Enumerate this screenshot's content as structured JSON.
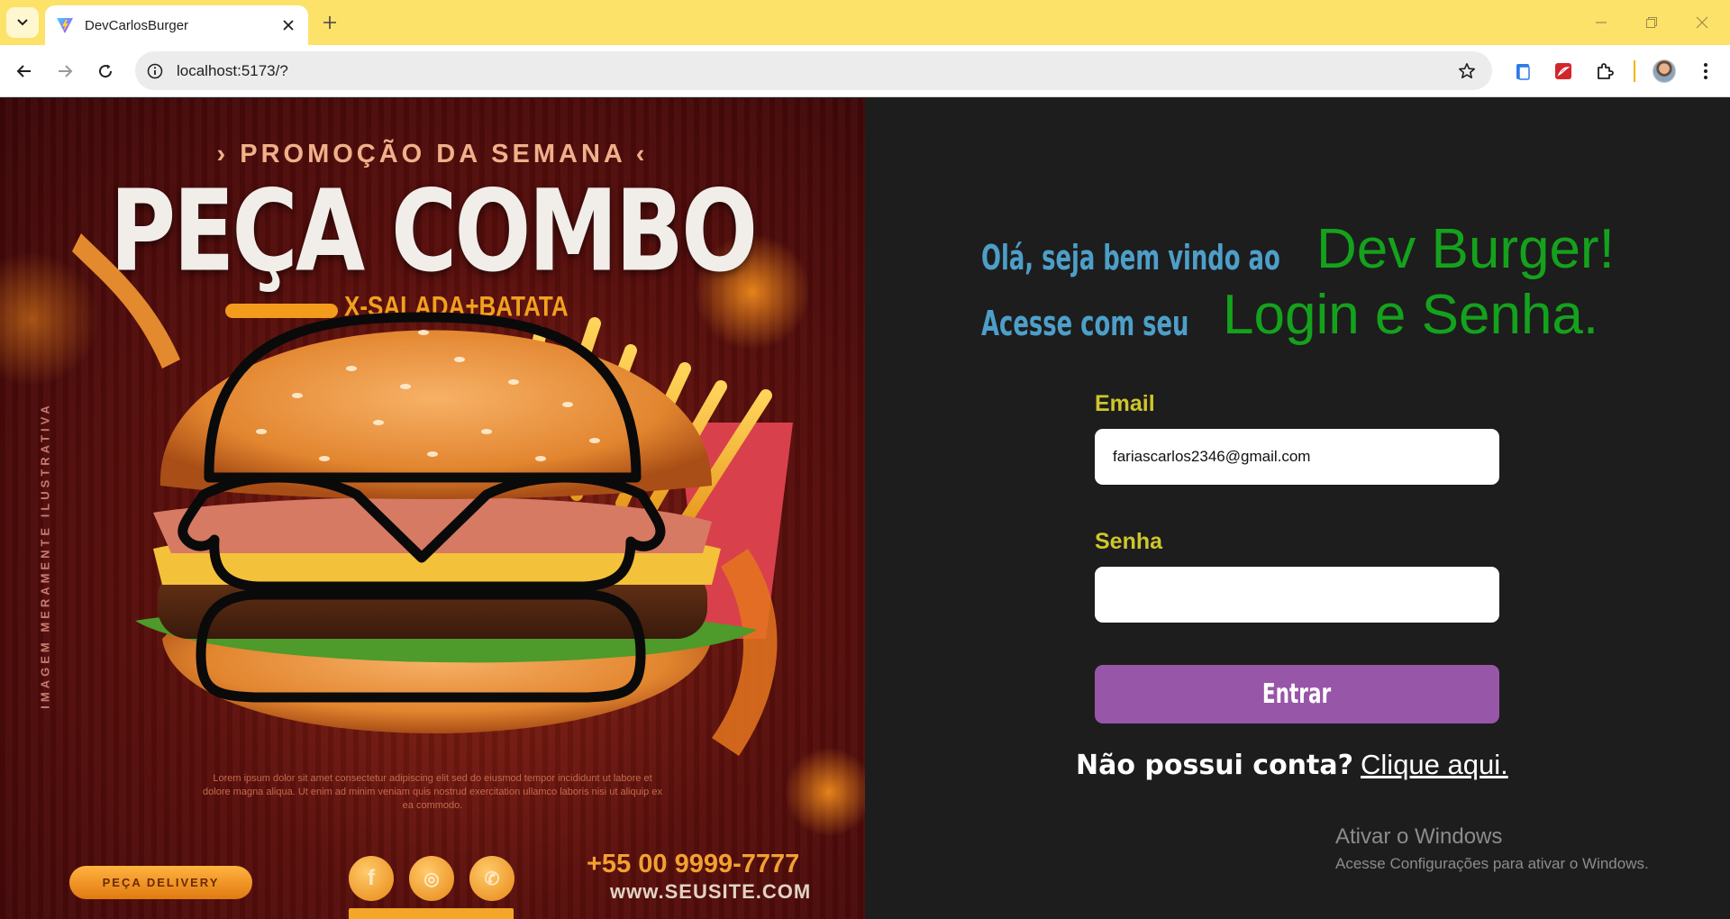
{
  "browser": {
    "tab_title": "DevCarlosBurger",
    "url": "localhost:5173/?"
  },
  "poster": {
    "promo": "› PROMOÇÃO DA SEMANA ‹",
    "headline": "PEÇA COMBO",
    "subheadline": "X-SALADA+BATATA",
    "side_text": "IMAGEM MERAMENTE ILUSTRATIVA",
    "blurb": "Lorem ipsum dolor sit amet consectetur adipiscing elit sed do eiusmod tempor incididunt ut labore et dolore magna aliqua. Ut enim ad minim veniam quis nostrud exercitation ullamco laboris nisi ut aliquip ex ea commodo.",
    "delivery_button": "PEÇA DELIVERY",
    "social_icons": [
      "facebook-icon",
      "instagram-icon",
      "whatsapp-icon"
    ],
    "phone": "+55 00 9999-7777",
    "site": "www.SEUSITE.COM"
  },
  "login": {
    "greeting_line1_prefix": "Olá, seja bem vindo ao",
    "greeting_line1_brand": "Dev Burger!",
    "greeting_line2_prefix": "Acesse com seu",
    "greeting_line2_emphasis": "Login e Senha.",
    "email_label": "Email",
    "email_value": "fariascarlos2346@gmail.com",
    "password_label": "Senha",
    "password_value": "",
    "submit_label": "Entrar",
    "signup_question": "Não possui conta?",
    "signup_link": "Clique aqui."
  },
  "windows_watermark": {
    "title": "Ativar o Windows",
    "subtitle": "Acesse Configurações para ativar o Windows."
  },
  "colors": {
    "tabbar": "#fde26a",
    "panel_bg": "#1d1d1d",
    "greeting_blue": "#4d9fc9",
    "greeting_green": "#14a21c",
    "label_yellow": "#cdc62c",
    "button_purple": "#9756a8"
  }
}
